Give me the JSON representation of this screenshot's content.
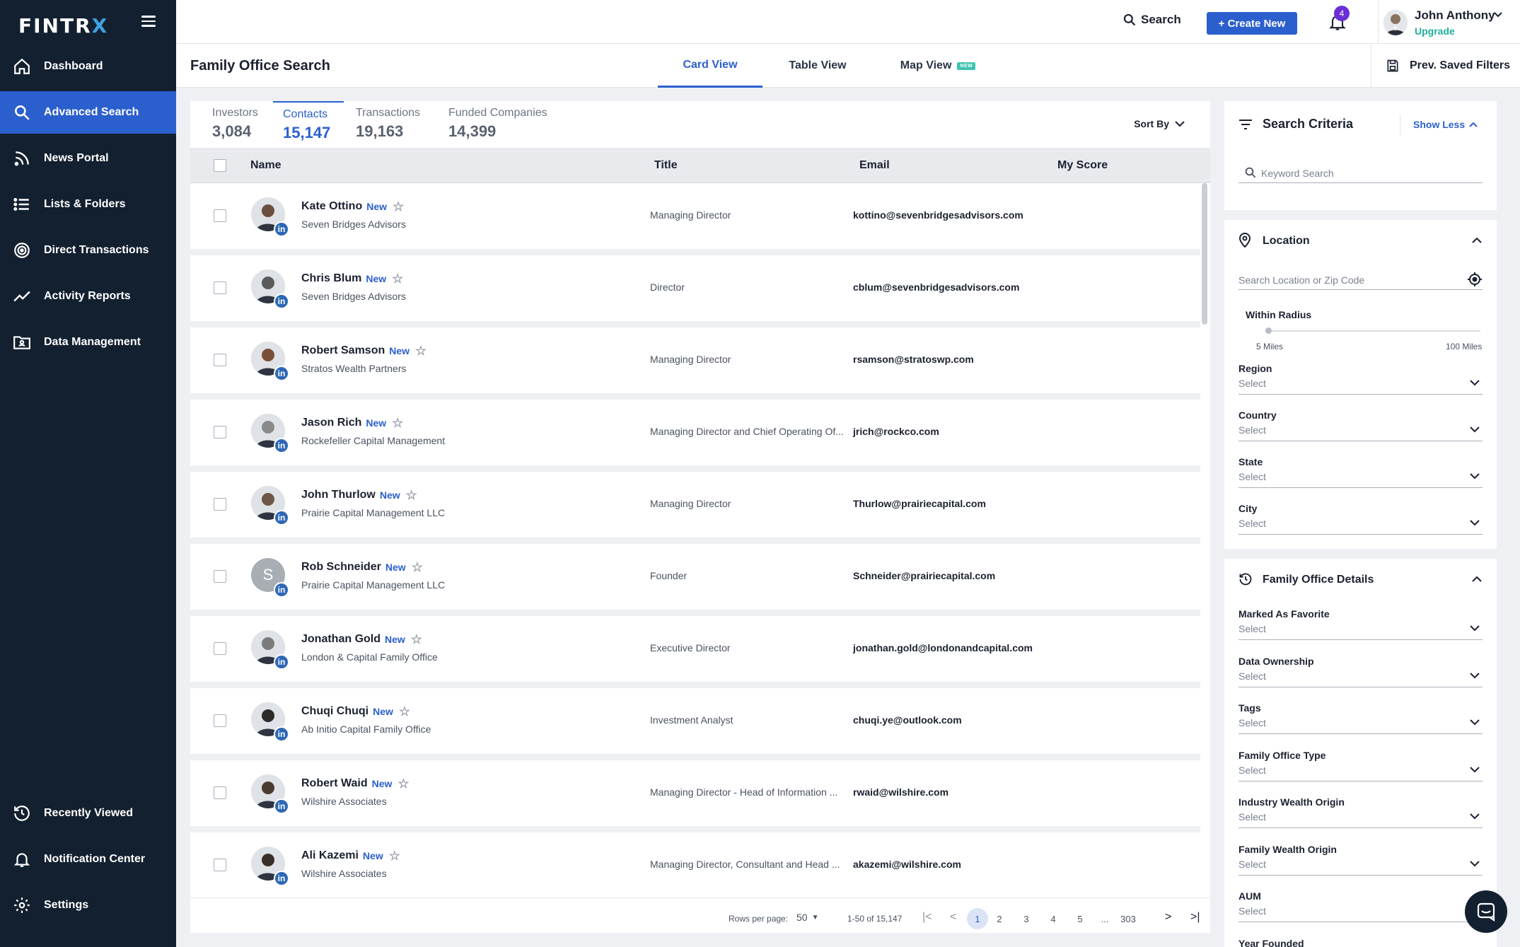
{
  "app": {
    "logo_text": "FINTR",
    "logo_x": "X"
  },
  "sidebar": {
    "items": [
      {
        "label": "Dashboard",
        "icon": "home-icon"
      },
      {
        "label": "Advanced Search",
        "icon": "search-icon",
        "active": true
      },
      {
        "label": "News Portal",
        "icon": "rss-icon"
      },
      {
        "label": "Lists & Folders",
        "icon": "list-icon"
      },
      {
        "label": "Direct Transactions",
        "icon": "target-icon"
      },
      {
        "label": "Activity Reports",
        "icon": "trend-icon"
      },
      {
        "label": "Data Management",
        "icon": "folder-user-icon"
      }
    ],
    "bottom_items": [
      {
        "label": "Recently Viewed",
        "icon": "history-icon"
      },
      {
        "label": "Notification Center",
        "icon": "bell-icon"
      },
      {
        "label": "Settings",
        "icon": "gear-icon"
      }
    ]
  },
  "topbar": {
    "search_label": "Search",
    "create_label": "+ Create New",
    "notification_count": "4",
    "user_name": "John Anthony",
    "upgrade_label": "Upgrade"
  },
  "page": {
    "title": "Family Office Search",
    "view_tabs": [
      {
        "label": "Card View",
        "active": true
      },
      {
        "label": "Table View"
      },
      {
        "label": "Map View",
        "badge": "NEW"
      }
    ],
    "saved_filters_label": "Prev. Saved Filters"
  },
  "results": {
    "stat_tabs": [
      {
        "label": "Investors",
        "value": "3,084"
      },
      {
        "label": "Contacts",
        "value": "15,147",
        "active": true
      },
      {
        "label": "Transactions",
        "value": "19,163"
      },
      {
        "label": "Funded Companies",
        "value": "14,399"
      }
    ],
    "sort_label": "Sort By",
    "columns": {
      "name": "Name",
      "title": "Title",
      "email": "Email",
      "score": "My Score"
    },
    "new_tag": "New",
    "rows": [
      {
        "name": "Kate Ottino",
        "company": "Seven Bridges Advisors",
        "title": "Managing Director",
        "email": "kottino@sevenbridgesadvisors.com",
        "initial": ""
      },
      {
        "name": "Chris Blum",
        "company": "Seven Bridges Advisors",
        "title": "Director",
        "email": "cblum@sevenbridgesadvisors.com",
        "initial": ""
      },
      {
        "name": "Robert Samson",
        "company": "Stratos Wealth Partners",
        "title": "Managing Director",
        "email": "rsamson@stratoswp.com",
        "initial": ""
      },
      {
        "name": "Jason Rich",
        "company": "Rockefeller Capital Management",
        "title": "Managing Director and Chief Operating Of...",
        "email": "jrich@rockco.com",
        "initial": ""
      },
      {
        "name": "John Thurlow",
        "company": "Prairie Capital Management LLC",
        "title": "Managing Director",
        "email": "Thurlow@prairiecapital.com",
        "initial": ""
      },
      {
        "name": "Rob Schneider",
        "company": "Prairie Capital Management LLC",
        "title": "Founder",
        "email": "Schneider@prairiecapital.com",
        "initial": "S"
      },
      {
        "name": "Jonathan Gold",
        "company": "London & Capital Family Office",
        "title": "Executive Director",
        "email": "jonathan.gold@londonandcapital.com",
        "initial": ""
      },
      {
        "name": "Chuqi Chuqi",
        "company": "Ab Initio Capital Family Office",
        "title": "Investment Analyst",
        "email": "chuqi.ye@outlook.com",
        "initial": ""
      },
      {
        "name": "Robert Waid",
        "company": "Wilshire Associates",
        "title": "Managing Director - Head of Information ...",
        "email": "rwaid@wilshire.com",
        "initial": ""
      },
      {
        "name": "Ali Kazemi",
        "company": "Wilshire Associates",
        "title": "Managing Director, Consultant and Head ...",
        "email": "akazemi@wilshire.com",
        "initial": ""
      }
    ],
    "pagination": {
      "rows_per_page_label": "Rows per page:",
      "rows_per_page": "50",
      "range": "1-50 of 15,147",
      "pages": [
        "1",
        "2",
        "3",
        "4",
        "5",
        "...",
        "303"
      ]
    }
  },
  "criteria": {
    "title": "Search Criteria",
    "toggle_label": "Show Less",
    "keyword_placeholder": "Keyword Search",
    "location": {
      "title": "Location",
      "search_placeholder": "Search Location or Zip Code",
      "radius_label": "Within Radius",
      "radius_min": "5 Miles",
      "radius_max": "100 Miles",
      "fields": [
        {
          "label": "Region",
          "value": "Select"
        },
        {
          "label": "Country",
          "value": "Select"
        },
        {
          "label": "State",
          "value": "Select"
        },
        {
          "label": "City",
          "value": "Select"
        }
      ]
    },
    "details": {
      "title": "Family Office Details",
      "fields": [
        {
          "label": "Marked As Favorite",
          "value": "Select"
        },
        {
          "label": "Data Ownership",
          "value": "Select"
        },
        {
          "label": "Tags",
          "value": "Select"
        },
        {
          "label": "Family Office Type",
          "value": "Select"
        },
        {
          "label": "Industry Wealth Origin",
          "value": "Select"
        },
        {
          "label": "Family Wealth Origin",
          "value": "Select"
        },
        {
          "label": "AUM",
          "value": "Select"
        },
        {
          "label": "Year Founded",
          "value": ""
        }
      ]
    }
  },
  "colors": {
    "accent": "#2c5fce",
    "sidebar": "#13202f",
    "teal": "#1fb09a",
    "badge": "#6b2fd8"
  }
}
